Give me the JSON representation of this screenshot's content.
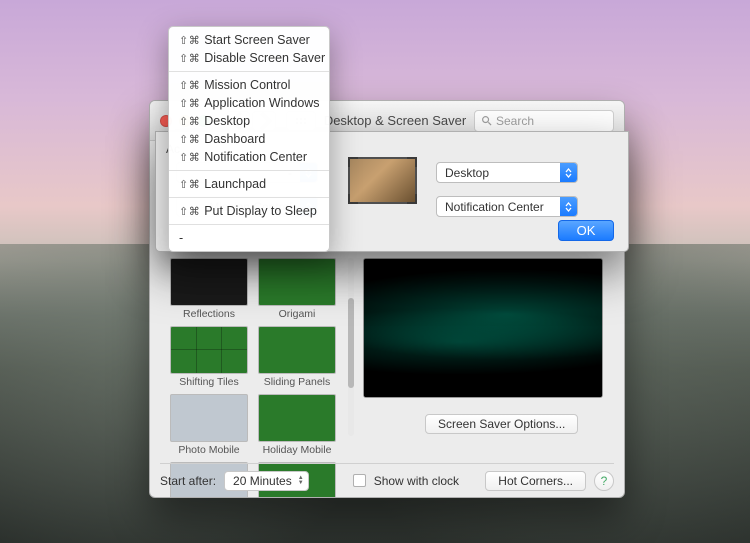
{
  "window": {
    "title": "Desktop & Screen Saver",
    "search_placeholder": "Search"
  },
  "thumbs": [
    {
      "label": "Reflections"
    },
    {
      "label": "Origami"
    },
    {
      "label": "Shifting Tiles"
    },
    {
      "label": "Sliding Panels"
    },
    {
      "label": "Photo Mobile"
    },
    {
      "label": "Holiday Mobile"
    }
  ],
  "buttons": {
    "screen_saver_options": "Screen Saver Options...",
    "hot_corners": "Hot Corners...",
    "ok": "OK",
    "help": "?"
  },
  "bottom": {
    "start_after_label": "Start after:",
    "start_after_value": "20 Minutes",
    "show_with_clock": "Show with clock"
  },
  "dialog": {
    "left_label": "Ac",
    "corners": {
      "top_left": "-",
      "top_right": "Desktop",
      "bottom_left": "Mission Control",
      "bottom_right": "Notification Center"
    }
  },
  "menu": {
    "modifier": "⇧⌘",
    "items_group1": [
      "Start Screen Saver",
      "Disable Screen Saver"
    ],
    "items_group2": [
      "Mission Control",
      "Application Windows",
      "Desktop",
      "Dashboard",
      "Notification Center"
    ],
    "items_group3": [
      "Launchpad"
    ],
    "items_group4": [
      "Put Display to Sleep"
    ],
    "items_group5": [
      "-"
    ]
  }
}
